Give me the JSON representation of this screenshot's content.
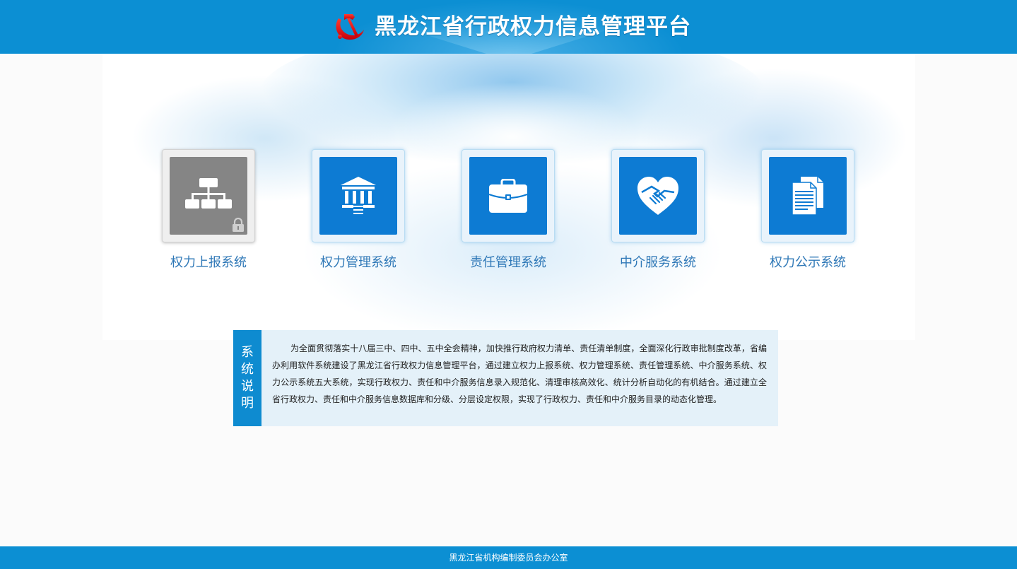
{
  "header": {
    "title": "黑龙江省行政权力信息管理平台",
    "emblem_icon": "party-emblem-icon",
    "background_color": "#0c8fd3"
  },
  "modules": [
    {
      "label": "权力上报系统",
      "icon": "org-chart-icon",
      "locked": true,
      "tile_color": "#858585"
    },
    {
      "label": "权力管理系统",
      "icon": "government-building-icon",
      "locked": false,
      "tile_color": "#0d7bd3"
    },
    {
      "label": "责任管理系统",
      "icon": "briefcase-icon",
      "locked": false,
      "tile_color": "#0d7bd3"
    },
    {
      "label": "中介服务系统",
      "icon": "heart-handshake-icon",
      "locked": false,
      "tile_color": "#0d7bd3"
    },
    {
      "label": "权力公示系统",
      "icon": "documents-icon",
      "locked": false,
      "tile_color": "#0d7bd3"
    }
  ],
  "description": {
    "tab_chars": [
      "系",
      "统",
      "说",
      "明"
    ],
    "text": "为全面贯彻落实十八届三中、四中、五中全会精神，加快推行政府权力清单、责任清单制度，全面深化行政审批制度改革，省编办利用软件系统建设了黑龙江省行政权力信息管理平台，通过建立权力上报系统、权力管理系统、责任管理系统、中介服务系统、权力公示系统五大系统，实现行政权力、责任和中介服务信息录入规范化、清理审核高效化、统计分析自动化的有机结合。通过建立全省行政权力、责任和中介服务信息数据库和分级、分层设定权限，实现了行政权力、责任和中介服务目录的动态化管理。"
  },
  "footer": {
    "text": "黑龙江省机构编制委员会办公室"
  }
}
